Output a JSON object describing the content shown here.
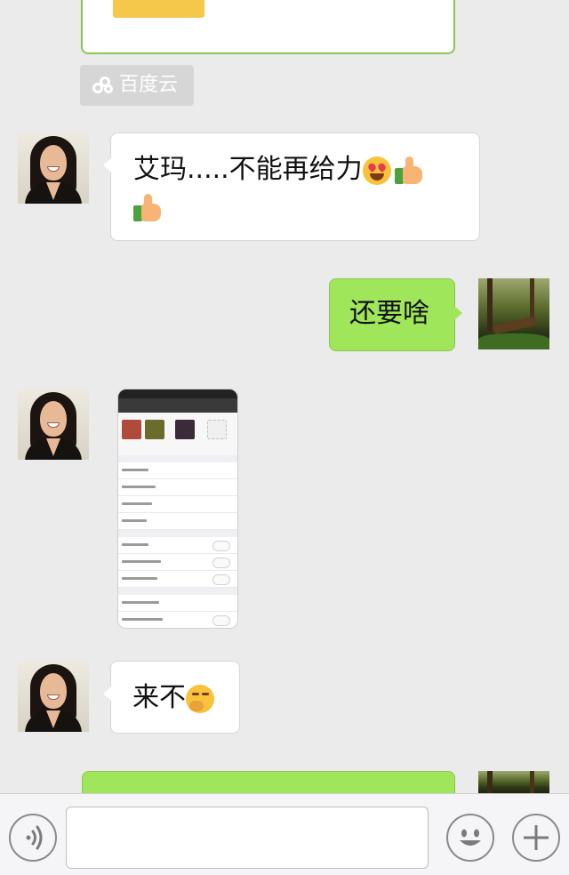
{
  "top_card": {
    "accent_color": "#f5c84b",
    "border_color": "#8cc652"
  },
  "cloud_tag": {
    "label": "百度云",
    "icon": "baidu-cloud-icon"
  },
  "messages": [
    {
      "id": "m1",
      "side": "left",
      "avatar": "woman-avatar",
      "text": "艾玛.....不能再给力",
      "emoji": [
        "heart-eyes-emoji",
        "thumbs-up-emoji",
        "thumbs-up-emoji"
      ]
    },
    {
      "id": "m2",
      "side": "right",
      "avatar": "forest-avatar",
      "text": "还要啥"
    },
    {
      "id": "m3",
      "side": "left",
      "avatar": "woman-avatar",
      "type": "image",
      "content": "group-settings-screenshot"
    },
    {
      "id": "m4",
      "side": "left",
      "avatar": "woman-avatar",
      "text": "来不",
      "emoji": [
        "thinking-emoji"
      ]
    },
    {
      "id": "m5",
      "side": "right",
      "avatar": "forest-avatar",
      "type": "partial"
    }
  ],
  "toolbar": {
    "voice_icon": "voice-icon",
    "input_placeholder": "",
    "emoji_icon": "smiley-icon",
    "more_icon": "plus-icon"
  },
  "colors": {
    "background": "#ebebeb",
    "bubble_green": "#9fe65a",
    "bubble_white": "#ffffff",
    "tag_gray": "#d6d6d6"
  }
}
